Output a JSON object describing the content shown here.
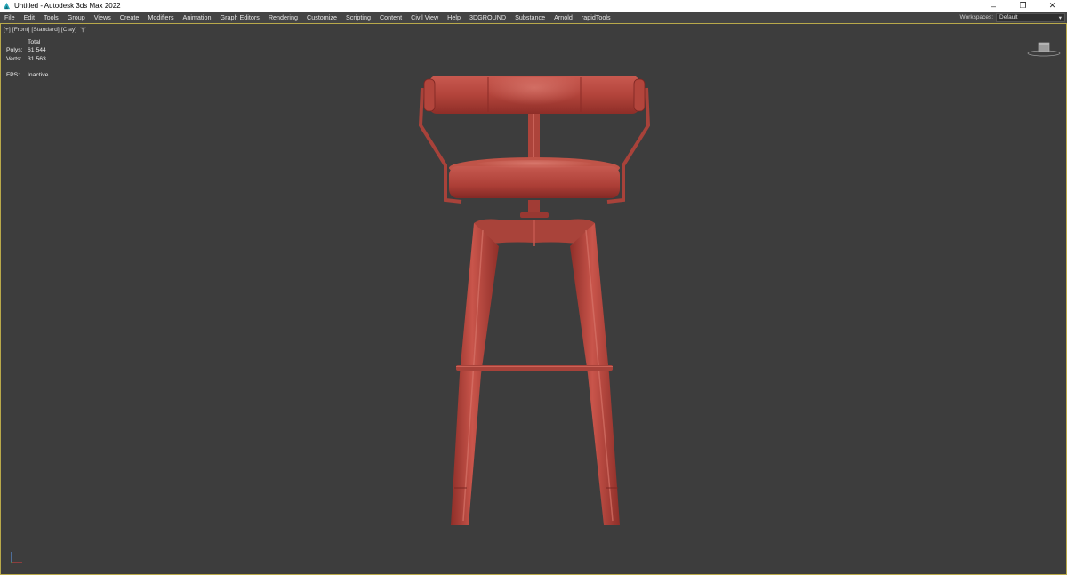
{
  "window": {
    "title": "Untitled - Autodesk 3ds Max 2022",
    "minimize_glyph": "–",
    "restore_glyph": "❐",
    "close_glyph": "✕"
  },
  "menu": {
    "items": [
      "File",
      "Edit",
      "Tools",
      "Group",
      "Views",
      "Create",
      "Modifiers",
      "Animation",
      "Graph Editors",
      "Rendering",
      "Customize",
      "Scripting",
      "Content",
      "Civil View",
      "Help",
      "3DGROUND",
      "Substance",
      "Arnold",
      "rapidTools"
    ],
    "workspaces_label": "Workspaces:",
    "workspace_value": "Default"
  },
  "viewport": {
    "label_parts": [
      "[+]",
      "[Front]",
      "[Standard]",
      "[Clay]"
    ],
    "filter_icon": "funnel-icon",
    "stats": {
      "total_label": "Total",
      "polys_label": "Polys:",
      "polys_value": "61 544",
      "verts_label": "Verts:",
      "verts_value": "31 563",
      "fps_label": "FPS:",
      "fps_value": "Inactive"
    },
    "model_color": "#b8443c",
    "border_color": "#b9a94a"
  }
}
